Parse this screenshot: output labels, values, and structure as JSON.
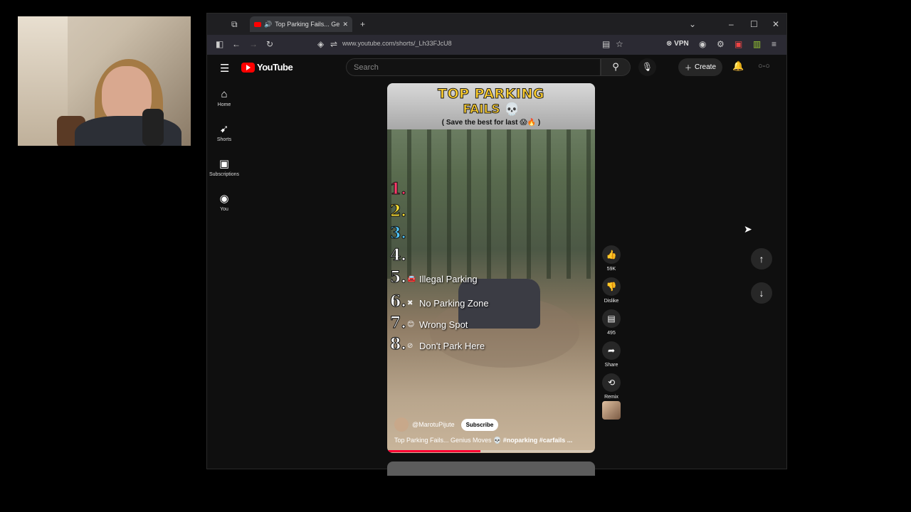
{
  "tab": {
    "title": "Top Parking Fails... Genius M"
  },
  "address": {
    "url": "www.youtube.com/shorts/_Lh33FJcU8",
    "vpn_label": "VPN"
  },
  "youtube": {
    "logo_text": "YouTube",
    "search_placeholder": "Search",
    "create_label": "Create",
    "sidebar": [
      {
        "label": "Home",
        "icon": "home-icon"
      },
      {
        "label": "Shorts",
        "icon": "shorts-icon"
      },
      {
        "label": "Subscriptions",
        "icon": "subscriptions-icon"
      },
      {
        "label": "You",
        "icon": "you-icon"
      }
    ]
  },
  "short": {
    "title_line1": "TOP PARKING",
    "title_line2": "FAILS 💀",
    "subtitle": "( Save the best for last 😱🔥 )",
    "list": [
      {
        "num": "1.",
        "label": "",
        "color": "#ff3b6b"
      },
      {
        "num": "2.",
        "label": "",
        "color": "#ffe234"
      },
      {
        "num": "3.",
        "label": "",
        "color": "#4fc3f7"
      },
      {
        "num": "4.",
        "label": "",
        "color": "#ffffff"
      },
      {
        "num": "5.",
        "label": "Illegal Parking",
        "color": "#ffffff"
      },
      {
        "num": "6.",
        "label": "No Parking Zone",
        "color": "#ffffff"
      },
      {
        "num": "7.",
        "label": "Wrong Spot",
        "color": "#ffffff"
      },
      {
        "num": "8.",
        "label": "Don't Park Here",
        "color": "#ffffff"
      }
    ],
    "channel": "@MarotuPijute",
    "subscribe_label": "Subscribe",
    "caption_plain": "Top Parking Fails... Genius Moves 💀 ",
    "caption_tags": "#noparking #carfails ...",
    "progress": 0.45
  },
  "actions": {
    "likes": "59K",
    "dislike_label": "Dislike",
    "comments": "495",
    "share_label": "Share",
    "remix_label": "Remix"
  }
}
